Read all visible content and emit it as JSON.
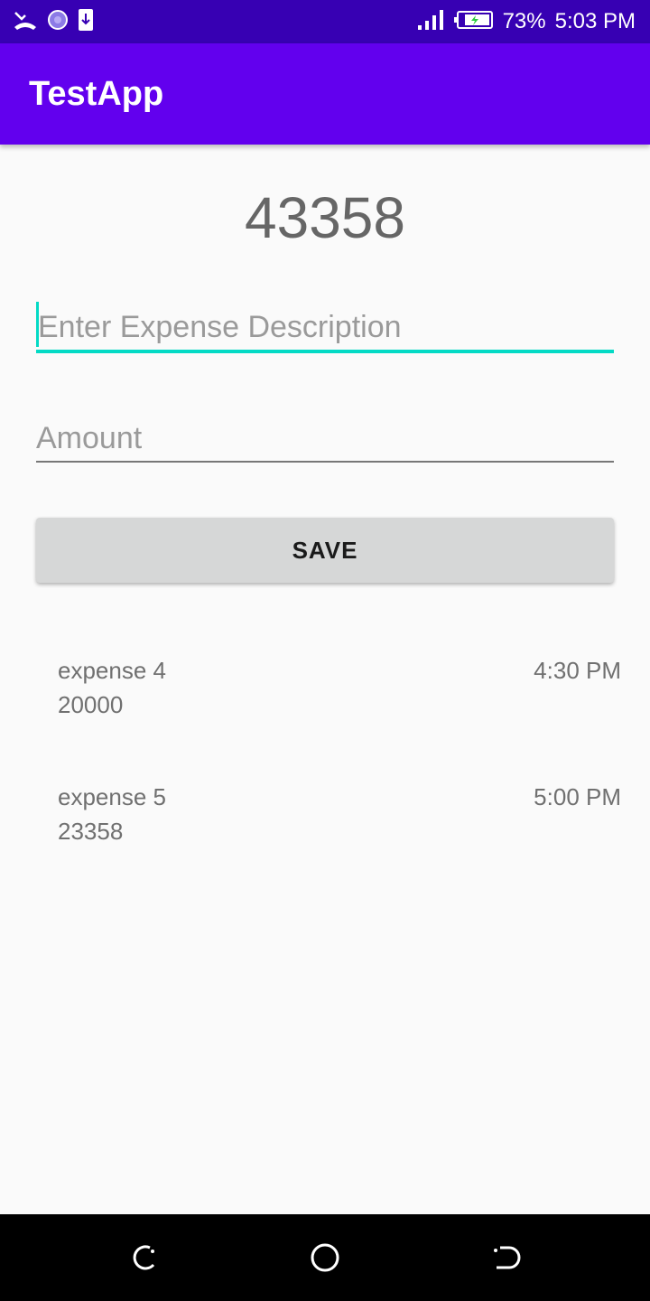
{
  "status_bar": {
    "battery_percent": "73%",
    "time": "5:03 PM",
    "icons": [
      "missed-call-icon",
      "loading-icon",
      "download-icon",
      "signal-icon",
      "battery-charging-icon"
    ]
  },
  "app_bar": {
    "title": "TestApp"
  },
  "total": "43358",
  "form": {
    "description_placeholder": "Enter Expense Description",
    "description_value": "",
    "amount_placeholder": "Amount",
    "amount_value": "",
    "save_label": "SAVE"
  },
  "expenses": [
    {
      "description": "expense 4",
      "amount": "20000",
      "time": "4:30 PM"
    },
    {
      "description": "expense 5",
      "amount": "23358",
      "time": "5:00 PM"
    }
  ],
  "nav_bar": {
    "icons": [
      "back-icon",
      "home-icon",
      "recents-icon"
    ]
  },
  "colors": {
    "status_bar": "#3700b3",
    "app_bar": "#6200ee",
    "accent": "#03dac5",
    "button": "#d6d7d7"
  }
}
